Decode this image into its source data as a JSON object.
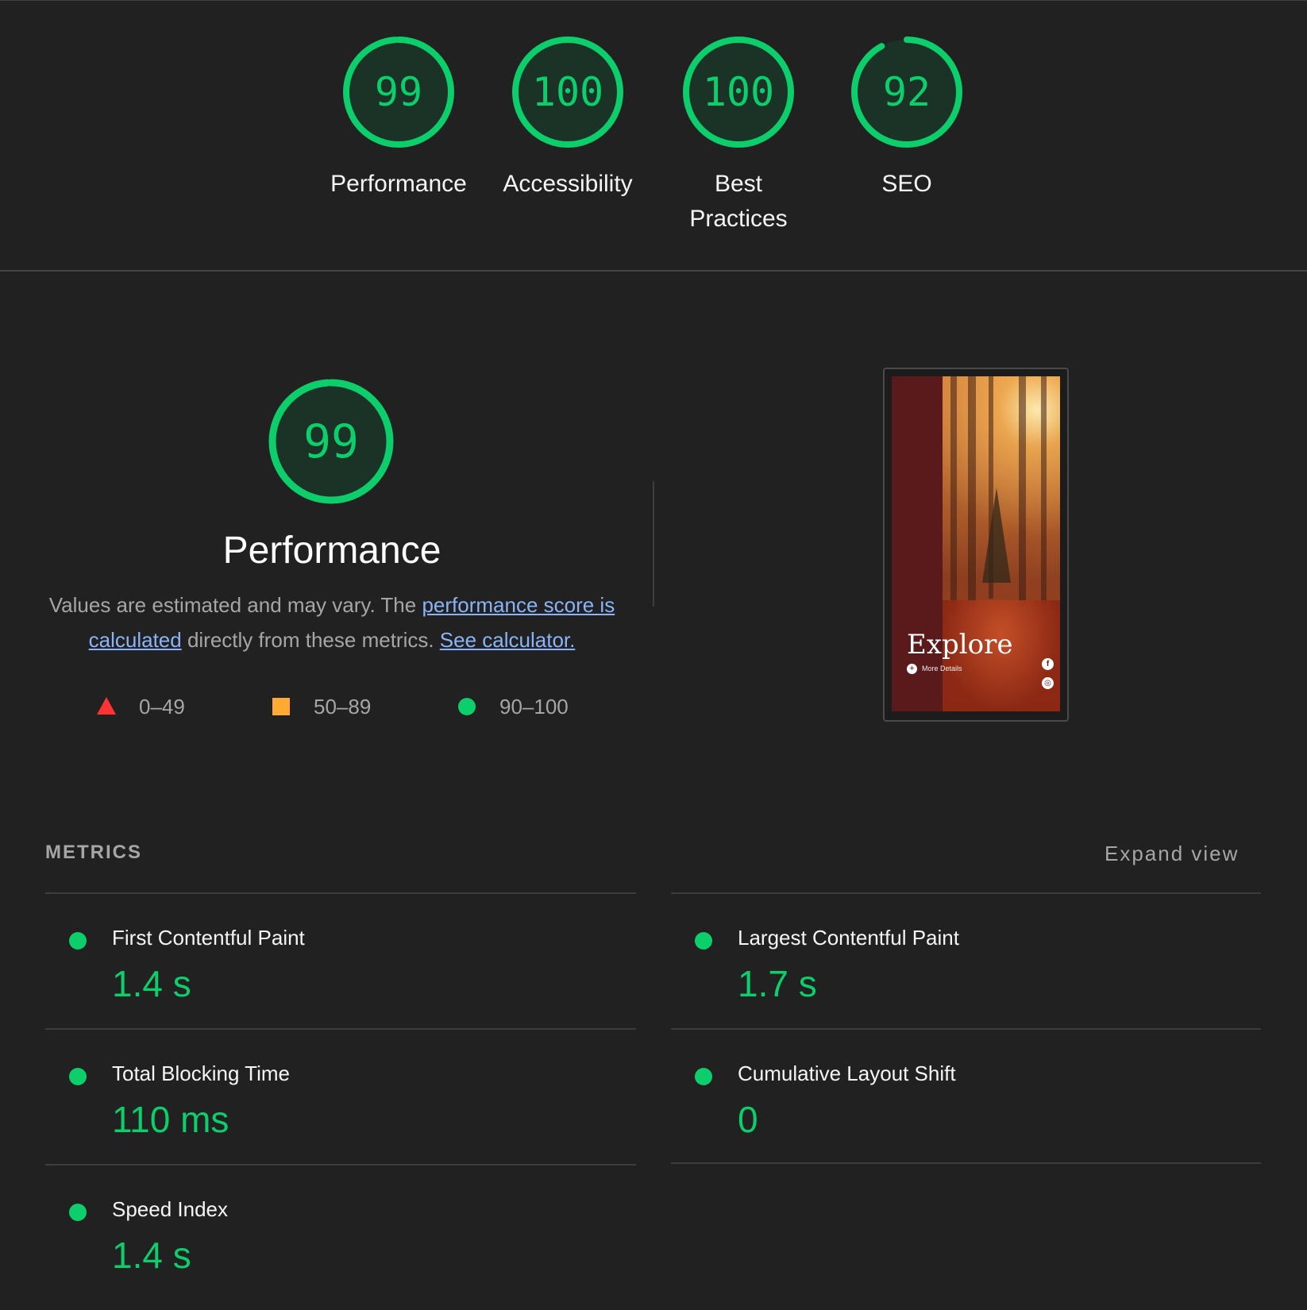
{
  "gauges": [
    {
      "score": "99",
      "label": "Performance",
      "value": 99
    },
    {
      "score": "100",
      "label": "Accessibility",
      "value": 100
    },
    {
      "score": "100",
      "label": "Best Practices",
      "value": 100
    },
    {
      "score": "92",
      "label": "SEO",
      "value": 92
    }
  ],
  "performance": {
    "score": "99",
    "value": 99,
    "title": "Performance",
    "desc_prefix": "Values are estimated and may vary. The ",
    "desc_link": "performance score is calculated",
    "desc_middle": " directly from these metrics. ",
    "calc_link": "See calculator."
  },
  "legend": [
    {
      "range": "0–49",
      "shape": "triangle",
      "color": "#ff3333"
    },
    {
      "range": "50–89",
      "shape": "square",
      "color": "#ffaa33"
    },
    {
      "range": "90–100",
      "shape": "circle",
      "color": "#0cce6b"
    }
  ],
  "thumbnail": {
    "heading": "Explore",
    "more_details": "More Details",
    "social_icons": [
      "facebook-icon",
      "instagram-icon"
    ]
  },
  "metrics": {
    "title": "METRICS",
    "expand_label": "Expand view",
    "items": [
      {
        "name": "First Contentful Paint",
        "value": "1.4 s"
      },
      {
        "name": "Largest Contentful Paint",
        "value": "1.7 s"
      },
      {
        "name": "Total Blocking Time",
        "value": "110 ms"
      },
      {
        "name": "Cumulative Layout Shift",
        "value": "0"
      },
      {
        "name": "Speed Index",
        "value": "1.4 s"
      }
    ]
  },
  "colors": {
    "pass": "#0cce6b",
    "average": "#ffaa33",
    "fail": "#ff3333",
    "background": "#212121"
  }
}
